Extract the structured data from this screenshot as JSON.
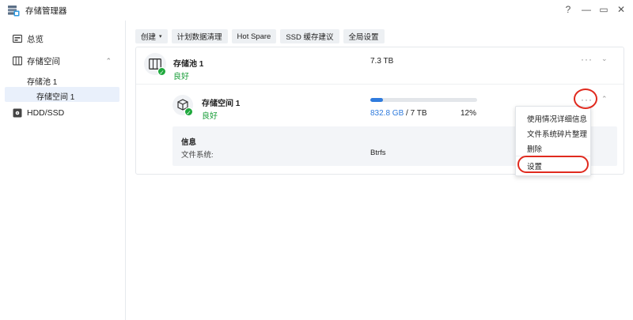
{
  "window": {
    "title": "存储管理器",
    "help": "?",
    "minimize": "—",
    "maximize": "▭",
    "close": "✕"
  },
  "sidebar": {
    "items": [
      {
        "label": "总览",
        "icon": "overview-icon"
      },
      {
        "label": "存储空间",
        "icon": "storage-icon",
        "chevron": "⌃"
      },
      {
        "label": "HDD/SSD",
        "icon": "disk-icon"
      }
    ],
    "sub_items": [
      {
        "label": "存储池 1"
      },
      {
        "label": "存储空间 1",
        "active": true
      }
    ]
  },
  "toolbar": {
    "create": "创建",
    "create_caret": "▾",
    "schedule_cleanup": "计划数据清理",
    "hot_spare": "Hot Spare",
    "ssd_cache": "SSD 缓存建议",
    "global_settings": "全局设置"
  },
  "pool": {
    "name": "存储池 1",
    "status": "良好",
    "capacity": "7.3 TB",
    "more": "···",
    "chevron": "⌄"
  },
  "volume": {
    "name": "存储空间 1",
    "status": "良好",
    "used": "832.8 GB",
    "separator": " / ",
    "total": "7 TB",
    "percent_text": "12%",
    "usage_fraction": 0.12,
    "more": "···",
    "chevron": "⌃"
  },
  "info": {
    "title": "信息",
    "fs_label": "文件系统:",
    "fs_value": "Btrfs"
  },
  "context_menu": {
    "items": [
      "使用情况详细信息",
      "文件系统碎片整理",
      "删除",
      "设置"
    ]
  },
  "colors": {
    "accent": "#2f7bdd",
    "good": "#1a9e3a",
    "highlight": "#e02a1e"
  }
}
